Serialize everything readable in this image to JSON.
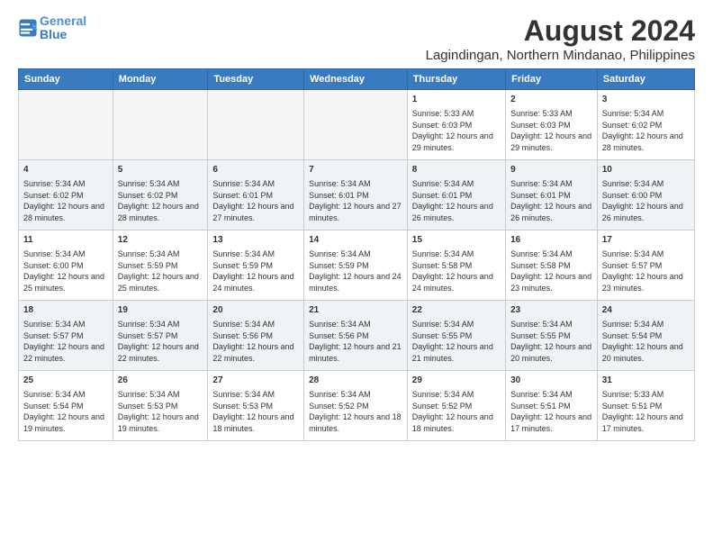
{
  "logo": {
    "line1": "General",
    "line2": "Blue"
  },
  "title": "August 2024",
  "subtitle": "Lagindingan, Northern Mindanao, Philippines",
  "days_of_week": [
    "Sunday",
    "Monday",
    "Tuesday",
    "Wednesday",
    "Thursday",
    "Friday",
    "Saturday"
  ],
  "weeks": [
    [
      {
        "day": "",
        "sunrise": "",
        "sunset": "",
        "daylight": ""
      },
      {
        "day": "",
        "sunrise": "",
        "sunset": "",
        "daylight": ""
      },
      {
        "day": "",
        "sunrise": "",
        "sunset": "",
        "daylight": ""
      },
      {
        "day": "",
        "sunrise": "",
        "sunset": "",
        "daylight": ""
      },
      {
        "day": "1",
        "sunrise": "5:33 AM",
        "sunset": "6:03 PM",
        "daylight": "12 hours and 29 minutes."
      },
      {
        "day": "2",
        "sunrise": "5:33 AM",
        "sunset": "6:03 PM",
        "daylight": "12 hours and 29 minutes."
      },
      {
        "day": "3",
        "sunrise": "5:34 AM",
        "sunset": "6:02 PM",
        "daylight": "12 hours and 28 minutes."
      }
    ],
    [
      {
        "day": "4",
        "sunrise": "5:34 AM",
        "sunset": "6:02 PM",
        "daylight": "12 hours and 28 minutes."
      },
      {
        "day": "5",
        "sunrise": "5:34 AM",
        "sunset": "6:02 PM",
        "daylight": "12 hours and 28 minutes."
      },
      {
        "day": "6",
        "sunrise": "5:34 AM",
        "sunset": "6:01 PM",
        "daylight": "12 hours and 27 minutes."
      },
      {
        "day": "7",
        "sunrise": "5:34 AM",
        "sunset": "6:01 PM",
        "daylight": "12 hours and 27 minutes."
      },
      {
        "day": "8",
        "sunrise": "5:34 AM",
        "sunset": "6:01 PM",
        "daylight": "12 hours and 26 minutes."
      },
      {
        "day": "9",
        "sunrise": "5:34 AM",
        "sunset": "6:01 PM",
        "daylight": "12 hours and 26 minutes."
      },
      {
        "day": "10",
        "sunrise": "5:34 AM",
        "sunset": "6:00 PM",
        "daylight": "12 hours and 26 minutes."
      }
    ],
    [
      {
        "day": "11",
        "sunrise": "5:34 AM",
        "sunset": "6:00 PM",
        "daylight": "12 hours and 25 minutes."
      },
      {
        "day": "12",
        "sunrise": "5:34 AM",
        "sunset": "5:59 PM",
        "daylight": "12 hours and 25 minutes."
      },
      {
        "day": "13",
        "sunrise": "5:34 AM",
        "sunset": "5:59 PM",
        "daylight": "12 hours and 24 minutes."
      },
      {
        "day": "14",
        "sunrise": "5:34 AM",
        "sunset": "5:59 PM",
        "daylight": "12 hours and 24 minutes."
      },
      {
        "day": "15",
        "sunrise": "5:34 AM",
        "sunset": "5:58 PM",
        "daylight": "12 hours and 24 minutes."
      },
      {
        "day": "16",
        "sunrise": "5:34 AM",
        "sunset": "5:58 PM",
        "daylight": "12 hours and 23 minutes."
      },
      {
        "day": "17",
        "sunrise": "5:34 AM",
        "sunset": "5:57 PM",
        "daylight": "12 hours and 23 minutes."
      }
    ],
    [
      {
        "day": "18",
        "sunrise": "5:34 AM",
        "sunset": "5:57 PM",
        "daylight": "12 hours and 22 minutes."
      },
      {
        "day": "19",
        "sunrise": "5:34 AM",
        "sunset": "5:57 PM",
        "daylight": "12 hours and 22 minutes."
      },
      {
        "day": "20",
        "sunrise": "5:34 AM",
        "sunset": "5:56 PM",
        "daylight": "12 hours and 22 minutes."
      },
      {
        "day": "21",
        "sunrise": "5:34 AM",
        "sunset": "5:56 PM",
        "daylight": "12 hours and 21 minutes."
      },
      {
        "day": "22",
        "sunrise": "5:34 AM",
        "sunset": "5:55 PM",
        "daylight": "12 hours and 21 minutes."
      },
      {
        "day": "23",
        "sunrise": "5:34 AM",
        "sunset": "5:55 PM",
        "daylight": "12 hours and 20 minutes."
      },
      {
        "day": "24",
        "sunrise": "5:34 AM",
        "sunset": "5:54 PM",
        "daylight": "12 hours and 20 minutes."
      }
    ],
    [
      {
        "day": "25",
        "sunrise": "5:34 AM",
        "sunset": "5:54 PM",
        "daylight": "12 hours and 19 minutes."
      },
      {
        "day": "26",
        "sunrise": "5:34 AM",
        "sunset": "5:53 PM",
        "daylight": "12 hours and 19 minutes."
      },
      {
        "day": "27",
        "sunrise": "5:34 AM",
        "sunset": "5:53 PM",
        "daylight": "12 hours and 18 minutes."
      },
      {
        "day": "28",
        "sunrise": "5:34 AM",
        "sunset": "5:52 PM",
        "daylight": "12 hours and 18 minutes."
      },
      {
        "day": "29",
        "sunrise": "5:34 AM",
        "sunset": "5:52 PM",
        "daylight": "12 hours and 18 minutes."
      },
      {
        "day": "30",
        "sunrise": "5:34 AM",
        "sunset": "5:51 PM",
        "daylight": "12 hours and 17 minutes."
      },
      {
        "day": "31",
        "sunrise": "5:33 AM",
        "sunset": "5:51 PM",
        "daylight": "12 hours and 17 minutes."
      }
    ]
  ],
  "labels": {
    "sunrise": "Sunrise:",
    "sunset": "Sunset:",
    "daylight": "Daylight:"
  }
}
